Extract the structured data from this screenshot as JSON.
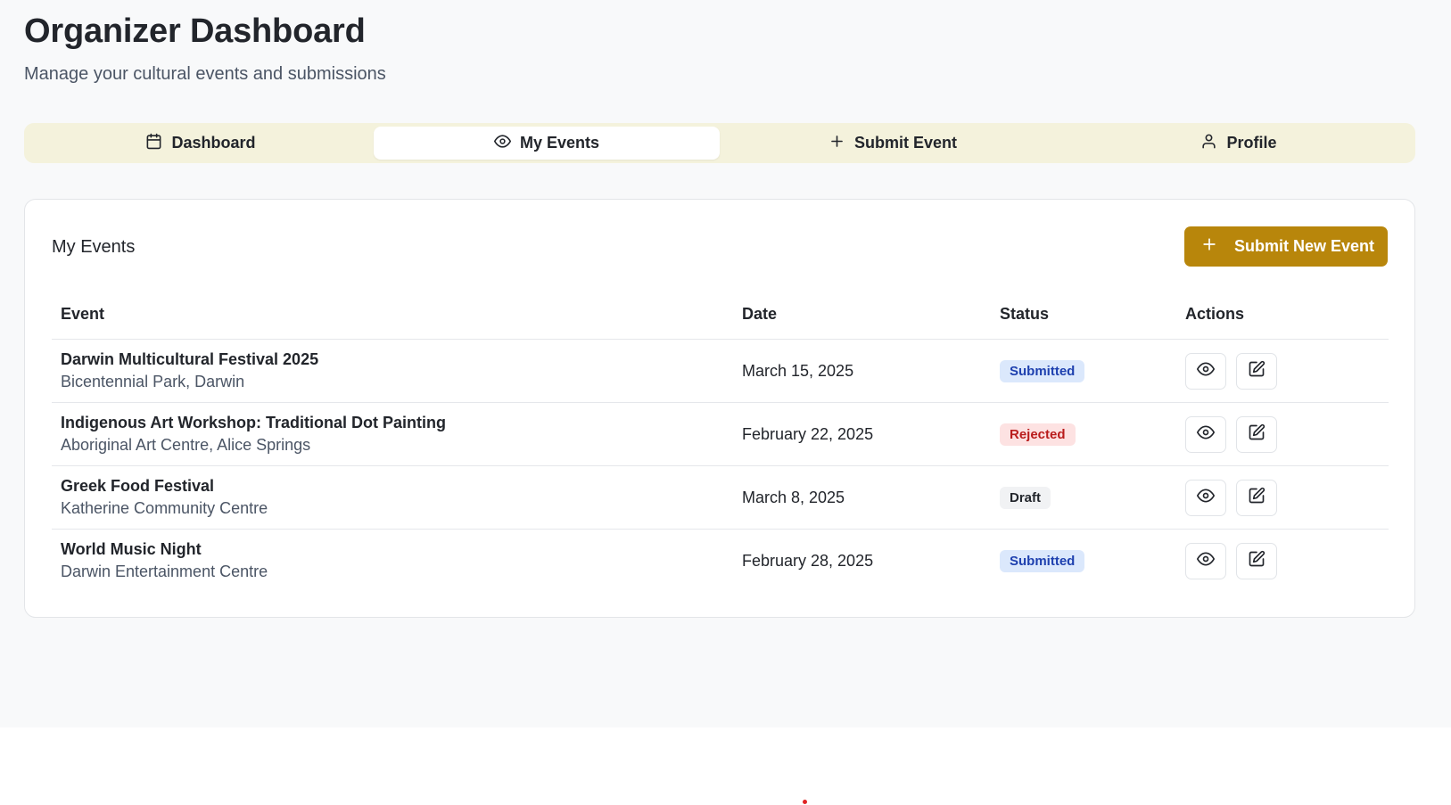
{
  "header": {
    "title": "Organizer Dashboard",
    "subtitle": "Manage your cultural events and submissions"
  },
  "tabs": [
    {
      "label": "Dashboard",
      "icon": "calendar-icon",
      "active": false
    },
    {
      "label": "My Events",
      "icon": "eye-icon",
      "active": true
    },
    {
      "label": "Submit Event",
      "icon": "plus-icon",
      "active": false
    },
    {
      "label": "Profile",
      "icon": "user-icon",
      "active": false
    }
  ],
  "events_card": {
    "title": "My Events",
    "submit_button_label": "Submit New Event",
    "columns": {
      "event": "Event",
      "date": "Date",
      "status": "Status",
      "actions": "Actions"
    },
    "rows": [
      {
        "name": "Darwin Multicultural Festival 2025",
        "location": "Bicentennial Park, Darwin",
        "date": "March 15, 2025",
        "status": "Submitted"
      },
      {
        "name": "Indigenous Art Workshop: Traditional Dot Painting",
        "location": "Aboriginal Art Centre, Alice Springs",
        "date": "February 22, 2025",
        "status": "Rejected"
      },
      {
        "name": "Greek Food Festival",
        "location": "Katherine Community Centre",
        "date": "March 8, 2025",
        "status": "Draft"
      },
      {
        "name": "World Music Night",
        "location": "Darwin Entertainment Centre",
        "date": "February 28, 2025",
        "status": "Submitted"
      }
    ]
  },
  "colors": {
    "accent": "#b8860b",
    "tab_bar_bg": "#f4f2dc",
    "status": {
      "Submitted": {
        "bg": "#dbe8fc",
        "fg": "#1e40af"
      },
      "Rejected": {
        "bg": "#fde2e2",
        "fg": "#b91c1c"
      },
      "Draft": {
        "bg": "#f1f2f4",
        "fg": "#22252b"
      }
    }
  }
}
